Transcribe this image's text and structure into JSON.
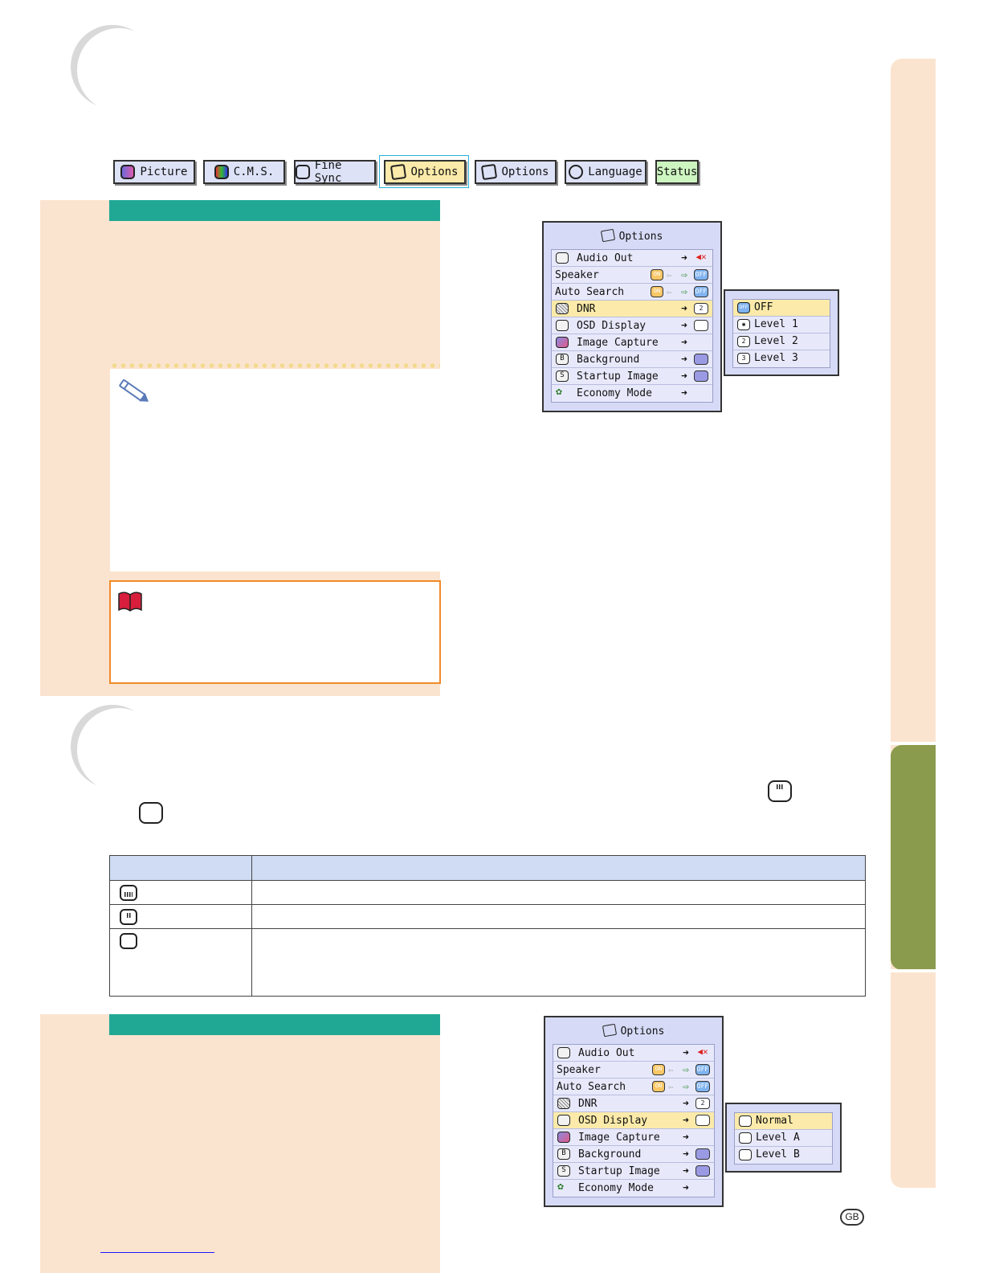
{
  "tabs": [
    {
      "label": "Picture",
      "icon": "picture-icon"
    },
    {
      "label": "C.M.S.",
      "icon": "cms-icon"
    },
    {
      "label": "Fine Sync",
      "icon": "fine-sync-icon"
    },
    {
      "label": "Options",
      "icon": "options-icon",
      "active": true
    },
    {
      "label": "Options",
      "icon": "options2-icon"
    },
    {
      "label": "Language",
      "icon": "language-icon"
    },
    {
      "label": "Status",
      "icon": ""
    }
  ],
  "menu1": {
    "title": "Options",
    "items": [
      {
        "label": "Audio Out",
        "value": "speaker"
      },
      {
        "label": "Speaker",
        "value": "ON/OFF"
      },
      {
        "label": "Auto Search",
        "value": "ON/OFF"
      },
      {
        "label": "DNR",
        "value": "2",
        "selected": true
      },
      {
        "label": "OSD Display",
        "value": "osd"
      },
      {
        "label": "Image Capture",
        "value": ""
      },
      {
        "label": "Background",
        "value": "bg"
      },
      {
        "label": "Startup Image",
        "value": "su"
      },
      {
        "label": "Economy Mode",
        "value": ""
      }
    ],
    "submenu": [
      "OFF",
      "Level 1",
      "Level 2",
      "Level 3"
    ],
    "submenu_icons": [
      "OFF",
      "✱",
      "2",
      "3"
    ]
  },
  "menu2": {
    "title": "Options",
    "items": [
      {
        "label": "Audio Out"
      },
      {
        "label": "Speaker"
      },
      {
        "label": "Auto Search"
      },
      {
        "label": "DNR"
      },
      {
        "label": "OSD Display",
        "selected": true
      },
      {
        "label": "Image Capture"
      },
      {
        "label": "Background"
      },
      {
        "label": "Startup Image"
      },
      {
        "label": "Economy Mode"
      }
    ],
    "submenu": [
      "Normal",
      "Level A",
      "Level B"
    ]
  },
  "colors": {
    "peach": "#fbe4cf",
    "teal": "#20a895",
    "green_tab": "#8b9b4e",
    "osd_bg": "#d6daf6",
    "selected": "#fbeaa9"
  },
  "footer": {
    "region_badge": "GB"
  }
}
